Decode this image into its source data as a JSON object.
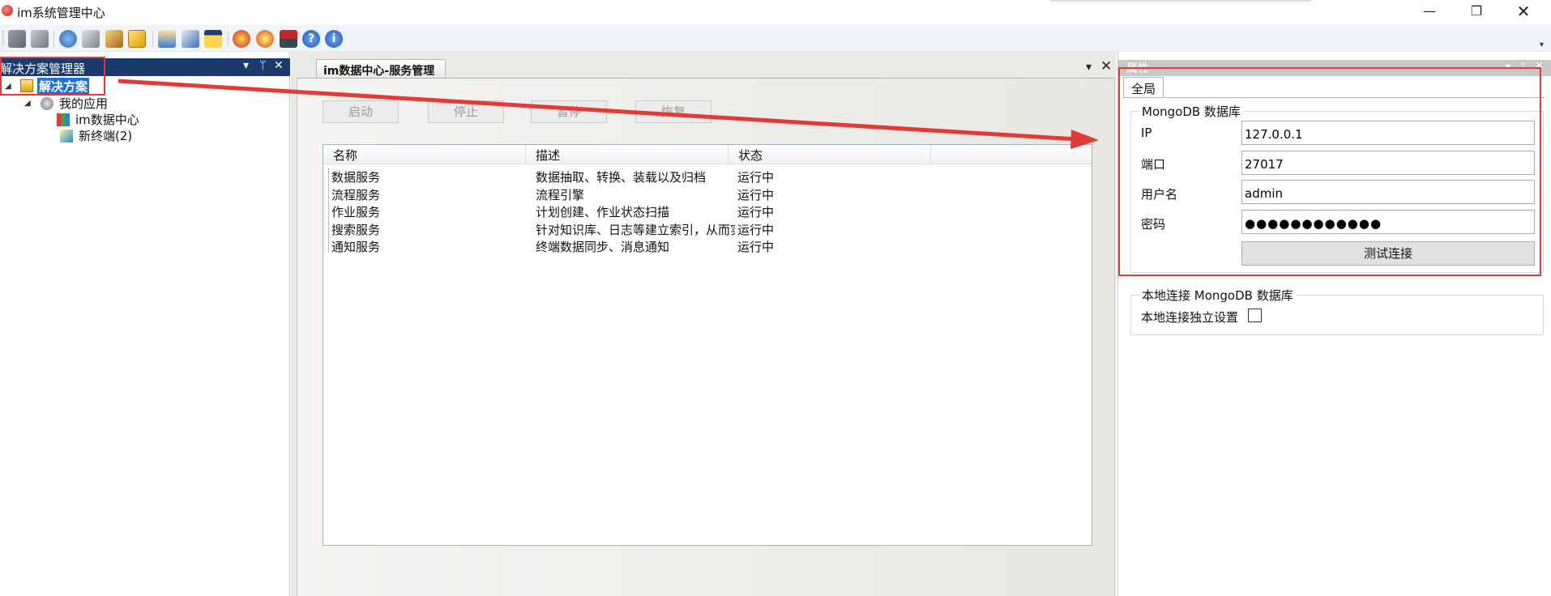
{
  "window": {
    "title": "im系统管理中心",
    "controls": {
      "minimize": "—",
      "maximize": "❐",
      "close": "✕"
    }
  },
  "toolbar": {
    "icons": [
      "gear-tool-icon",
      "logout-icon",
      "settings-icon",
      "server-config-icon",
      "users-config-icon",
      "alert-icon",
      "window-icon",
      "report-icon",
      "calendar-icon",
      "award-icon",
      "award-star-icon",
      "pin-icon",
      "help-icon",
      "info-icon"
    ],
    "overflow": "▾"
  },
  "solution_panel": {
    "title": "解决方案管理器",
    "controls": {
      "menu": "▾",
      "pin": "ᛘ",
      "close": "✕"
    },
    "tree": {
      "root": "解决方案",
      "app": "我的应用",
      "children": [
        "im数据中心",
        "新终端(2)"
      ]
    }
  },
  "document": {
    "tab_label": "im数据中心-服务管理",
    "tab_menu": "▾",
    "tab_close": "✕",
    "buttons": {
      "start": "启动",
      "stop": "停止",
      "pause": "暂停",
      "resume": "恢复"
    },
    "grid": {
      "columns": [
        "名称",
        "描述",
        "状态"
      ],
      "rows": [
        [
          "数据服务",
          "数据抽取、转换、装载以及归档",
          "运行中"
        ],
        [
          "流程服务",
          "流程引擎",
          "运行中"
        ],
        [
          "作业服务",
          "计划创建、作业状态扫描",
          "运行中"
        ],
        [
          "搜索服务",
          "针对知识库、日志等建立索引，从而实",
          "运行中"
        ],
        [
          "通知服务",
          "终端数据同步、消息通知",
          "运行中"
        ]
      ]
    }
  },
  "properties": {
    "title": "属性",
    "tab": "全局",
    "mongo_group": {
      "legend": "MongoDB 数据库",
      "ip_label": "IP",
      "ip_value": "127.0.0.1",
      "port_label": "端口",
      "port_value": "27017",
      "user_label": "用户名",
      "user_value": "admin",
      "password_label": "密码",
      "password_value": "●●●●●●●●●●●●",
      "test_button": "测试连接"
    },
    "local_group": {
      "legend": "本地连接 MongoDB 数据库",
      "checkbox_label": "本地连接独立设置",
      "checked": false
    }
  },
  "colors": {
    "annotation_red": "#e53935",
    "panel_header": "#1b3b6f",
    "selection": "#1e73d2"
  }
}
